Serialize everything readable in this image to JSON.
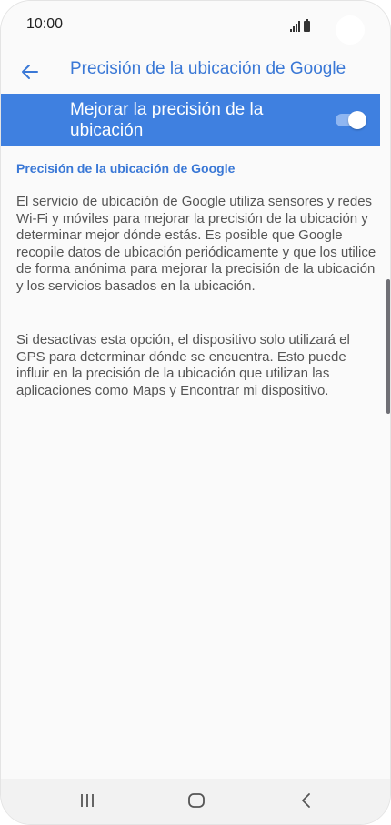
{
  "status_bar": {
    "time": "10:00"
  },
  "app_bar": {
    "title": "Precisión de la ubicación de Google",
    "back_icon": "arrow-left-icon"
  },
  "master_switch": {
    "label": "Mejorar la precisión de la ubicación",
    "state": "on"
  },
  "content": {
    "section_title": "Precisión de la ubicación de Google",
    "paragraph_1": "El servicio de ubicación de Google utiliza sensores y redes Wi-Fi y móviles para mejorar la precisión de la ubicación y determinar mejor dónde estás. Es posible que Google recopile datos de ubicación periódicamente y que los utilice de forma anónima para mejorar la precisión de la ubicación y los servicios basados en la ubicación.",
    "paragraph_2": "Si desactivas esta opción, el dispositivo solo utilizará el GPS para determinar dónde se encuentra. Esto puede influir en la precisión de la ubicación que utilizan las aplicaciones como Maps y Encontrar mi dispositivo."
  },
  "nav_bar": {
    "recents_icon": "recents-icon",
    "home_icon": "home-icon",
    "back_icon": "nav-back-icon"
  },
  "colors": {
    "accent": "#3a78d6",
    "switch_bar": "#3f80e0",
    "background": "#fafafa",
    "text": "#555555"
  }
}
